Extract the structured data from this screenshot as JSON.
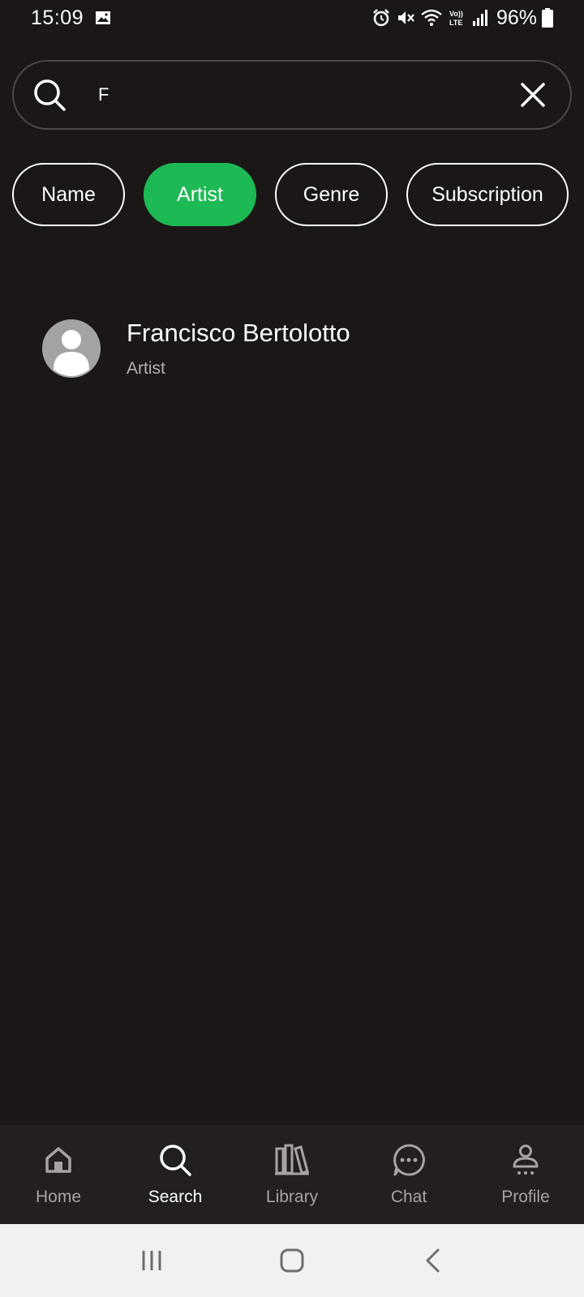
{
  "status_bar": {
    "time": "15:09",
    "battery": "96%",
    "icons": [
      "gallery-icon",
      "alarm-icon",
      "mute-icon",
      "wifi-icon",
      "volte-icon",
      "signal-icon",
      "battery-icon"
    ]
  },
  "search": {
    "value": "F",
    "placeholder": ""
  },
  "filters": {
    "name": "Name",
    "artist": "Artist",
    "genre": "Genre",
    "subscription": "Subscription",
    "active": "Artist"
  },
  "results": [
    {
      "title": "Francisco Bertolotto",
      "subtitle": "Artist"
    }
  ],
  "bottom_nav": {
    "home": "Home",
    "search": "Search",
    "library": "Library",
    "chat": "Chat",
    "profile": "Profile",
    "active": "Search"
  },
  "colors": {
    "background": "#1a1716",
    "accent": "#1db954",
    "nav_background": "#221f1e",
    "system_nav": "#f1f1f1"
  }
}
